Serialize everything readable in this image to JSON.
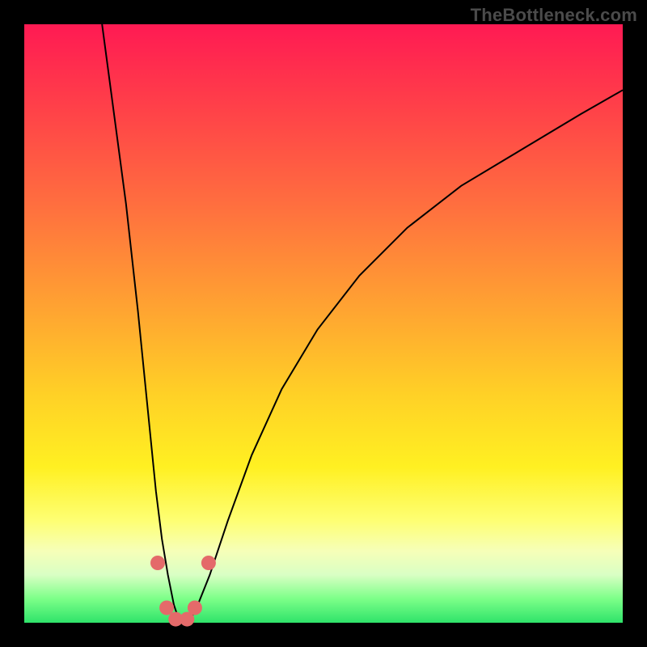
{
  "watermark": "TheBottleneck.com",
  "chart_data": {
    "type": "line",
    "title": "",
    "xlabel": "",
    "ylabel": "",
    "xlim": [
      0,
      100
    ],
    "ylim": [
      0,
      100
    ],
    "series": [
      {
        "name": "bottleneck-curve",
        "x": [
          13,
          15,
          17,
          19,
          20,
          21,
          22,
          23,
          24,
          25,
          26,
          27,
          28,
          29,
          31,
          34,
          38,
          43,
          49,
          56,
          64,
          73,
          83,
          93,
          100
        ],
        "values": [
          100,
          85,
          70,
          52,
          42,
          32,
          22,
          14,
          8,
          3,
          0,
          0,
          1,
          3,
          8,
          17,
          28,
          39,
          49,
          58,
          66,
          73,
          79,
          85,
          89
        ]
      }
    ],
    "markers": {
      "name": "highlight-dots",
      "color": "#e46a6a",
      "points": [
        {
          "x": 22.3,
          "y": 10
        },
        {
          "x": 23.8,
          "y": 2.5
        },
        {
          "x": 25.3,
          "y": 0.6
        },
        {
          "x": 27.2,
          "y": 0.6
        },
        {
          "x": 28.5,
          "y": 2.5
        },
        {
          "x": 30.8,
          "y": 10
        }
      ]
    }
  }
}
